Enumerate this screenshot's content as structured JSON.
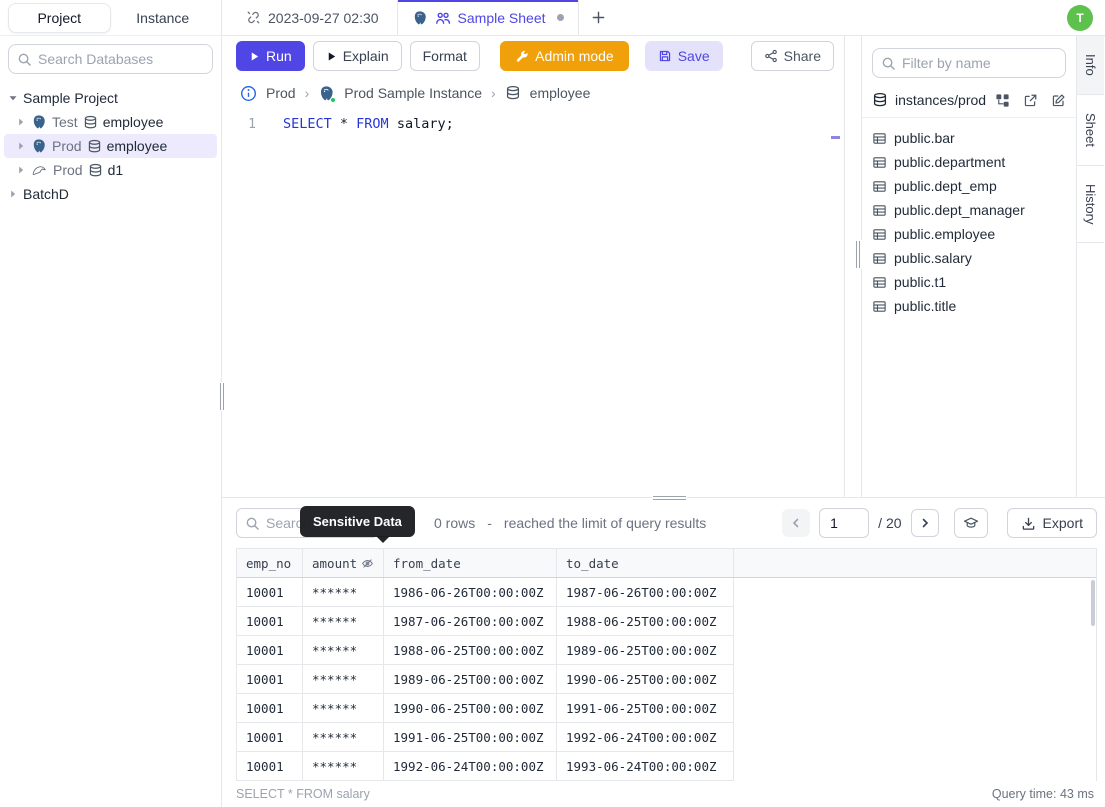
{
  "user": {
    "avatar_initial": "T"
  },
  "colors": {
    "accent": "#4f46e5",
    "admin_orange": "#efa00b",
    "avatar_green": "#5ec14e",
    "keyword_blue": "#2936d6",
    "selection_bg": "#eceafc",
    "status_green": "#22c55e"
  },
  "left_sidebar": {
    "tabs": [
      {
        "label": "Project",
        "active": true
      },
      {
        "label": "Instance",
        "active": false
      }
    ],
    "search_placeholder": "Search Databases",
    "tree": {
      "project1": "Sample Project",
      "databases": [
        {
          "env": "Test",
          "name": "employee",
          "engine": "postgresql"
        },
        {
          "env": "Prod",
          "name": "employee",
          "engine": "postgresql",
          "selected": true
        },
        {
          "env": "Prod",
          "name": "d1",
          "engine": "mysql"
        }
      ],
      "project2": "BatchD"
    }
  },
  "tabbar": {
    "tabs": [
      {
        "label": "2023-09-27 02:30",
        "icon": "unlink-icon",
        "active": false
      },
      {
        "label": "Sample Sheet",
        "icons": [
          "postgresql-icon",
          "people-icon"
        ],
        "active": true,
        "unsaved": true
      }
    ],
    "new_tab_label": "+"
  },
  "toolbar": {
    "run_label": "Run",
    "explain_label": "Explain",
    "format_label": "Format",
    "admin_mode_label": "Admin mode",
    "save_label": "Save",
    "share_label": "Share"
  },
  "breadcrumb": {
    "environment": "Prod",
    "instance": "Prod Sample Instance",
    "database": "employee"
  },
  "editor": {
    "line_number": "1",
    "keyword1": "SELECT",
    "operator": " * ",
    "keyword2": "FROM",
    "tail": " salary;"
  },
  "right_panel": {
    "filter_placeholder": "Filter by name",
    "connection_label": "instances/prod",
    "tables": [
      "public.bar",
      "public.department",
      "public.dept_emp",
      "public.dept_manager",
      "public.employee",
      "public.salary",
      "public.t1",
      "public.title"
    ]
  },
  "side_tabs": [
    {
      "label": "Info",
      "active": true
    },
    {
      "label": "Sheet",
      "active": false
    },
    {
      "label": "History",
      "active": false
    }
  ],
  "results": {
    "search_placeholder": "Search",
    "tooltip": "Sensitive Data",
    "rows_info": "0 rows",
    "separator": "-",
    "limit_message": "reached the limit of query results",
    "pagination": {
      "current": "1",
      "total": "/ 20"
    },
    "export_label": "Export",
    "table": {
      "columns": [
        "emp_no",
        "amount",
        "from_date",
        "to_date"
      ],
      "masked_column": "amount",
      "rows": [
        [
          "10001",
          "******",
          "1986-06-26T00:00:00Z",
          "1987-06-26T00:00:00Z"
        ],
        [
          "10001",
          "******",
          "1987-06-26T00:00:00Z",
          "1988-06-25T00:00:00Z"
        ],
        [
          "10001",
          "******",
          "1988-06-25T00:00:00Z",
          "1989-06-25T00:00:00Z"
        ],
        [
          "10001",
          "******",
          "1989-06-25T00:00:00Z",
          "1990-06-25T00:00:00Z"
        ],
        [
          "10001",
          "******",
          "1990-06-25T00:00:00Z",
          "1991-06-25T00:00:00Z"
        ],
        [
          "10001",
          "******",
          "1991-06-25T00:00:00Z",
          "1992-06-24T00:00:00Z"
        ],
        [
          "10001",
          "******",
          "1992-06-24T00:00:00Z",
          "1993-06-24T00:00:00Z"
        ]
      ]
    },
    "status_left": "SELECT * FROM salary",
    "status_right": "Query time: 43 ms"
  }
}
